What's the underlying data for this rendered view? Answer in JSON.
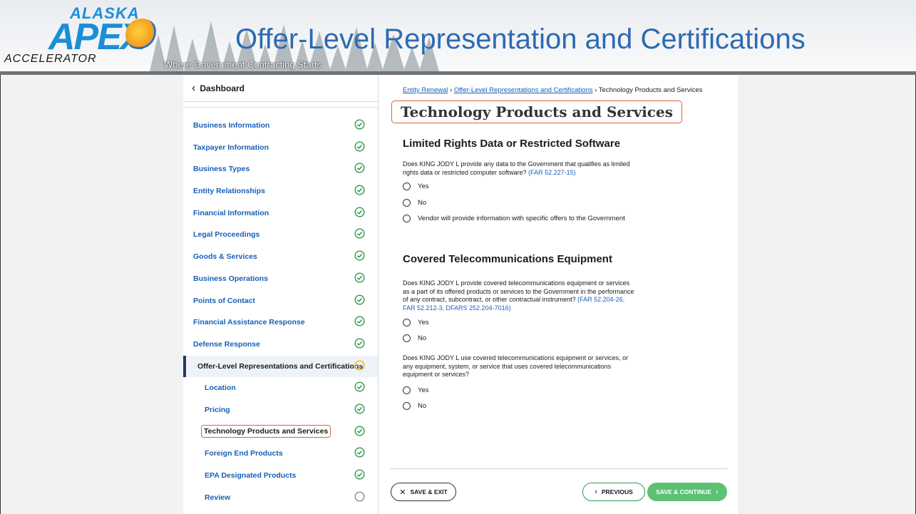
{
  "slide": {
    "logo_line1": "ALASKA",
    "logo_line2": "APEX",
    "logo_line3": "ACCELERATOR",
    "tagline": "Where Government Contracting Starts",
    "title": "Offer-Level Representation and Certifications"
  },
  "sidebar": {
    "back_label": "Dashboard",
    "items": [
      {
        "label": "Business Information",
        "status": "complete"
      },
      {
        "label": "Taxpayer Information",
        "status": "complete"
      },
      {
        "label": "Business Types",
        "status": "complete"
      },
      {
        "label": "Entity Relationships",
        "status": "complete"
      },
      {
        "label": "Financial Information",
        "status": "complete"
      },
      {
        "label": "Legal Proceedings",
        "status": "complete"
      },
      {
        "label": "Goods & Services",
        "status": "complete"
      },
      {
        "label": "Business Operations",
        "status": "complete"
      },
      {
        "label": "Points of Contact",
        "status": "complete"
      },
      {
        "label": "Financial Assistance Response",
        "status": "complete"
      },
      {
        "label": "Defense Response",
        "status": "complete"
      },
      {
        "label": "Offer-Level Representations and Certifications",
        "status": "in-progress"
      },
      {
        "label": "Location",
        "status": "complete"
      },
      {
        "label": "Pricing",
        "status": "complete"
      },
      {
        "label": "Technology Products and Services",
        "status": "complete"
      },
      {
        "label": "Foreign End Products",
        "status": "complete"
      },
      {
        "label": "EPA Designated Products",
        "status": "complete"
      },
      {
        "label": "Review",
        "status": "not-started"
      }
    ]
  },
  "breadcrumb": {
    "item1": "Entity Renewal",
    "item2": "Offer-Level Representations and Certifications",
    "current": "Technology Products and Services",
    "separator": "›"
  },
  "main": {
    "page_title": "Technology Products and Services",
    "section1": {
      "heading": "Limited Rights Data or Restricted Software",
      "question": "Does KING JODY L provide any data to the Government that qualifies as limited rights data or restricted computer software?",
      "ref": "(FAR 52.227-15)",
      "options": [
        "Yes",
        "No",
        "Vendor will provide information with specific offers to the Government"
      ]
    },
    "section2": {
      "heading": "Covered Telecommunications Equipment",
      "q1": "Does KING JODY L provide covered telecommunications equipment or services as a part of its offered products or services to the Government in the performance of any contract, subcontract, or other contractual instrument?",
      "q1_ref": "(FAR 52.204-26, FAR 52.212-3, DFARS 252.204-7016)",
      "q1_options": [
        "Yes",
        "No"
      ],
      "q2": "Does KING JODY L use covered telecommunications equipment or services, or any equipment, system, or service that uses covered telecommunications equipment or services?",
      "q2_options": [
        "Yes",
        "No"
      ]
    }
  },
  "footer": {
    "save_exit": "SAVE & EXIT",
    "previous": "PREVIOUS",
    "save_continue": "SAVE & CONTINUE"
  },
  "colors": {
    "accent_blue": "#175fb8",
    "success_green": "#2e9a4e",
    "warning_yellow": "#f0b400",
    "highlight_orange": "#e0622c"
  }
}
